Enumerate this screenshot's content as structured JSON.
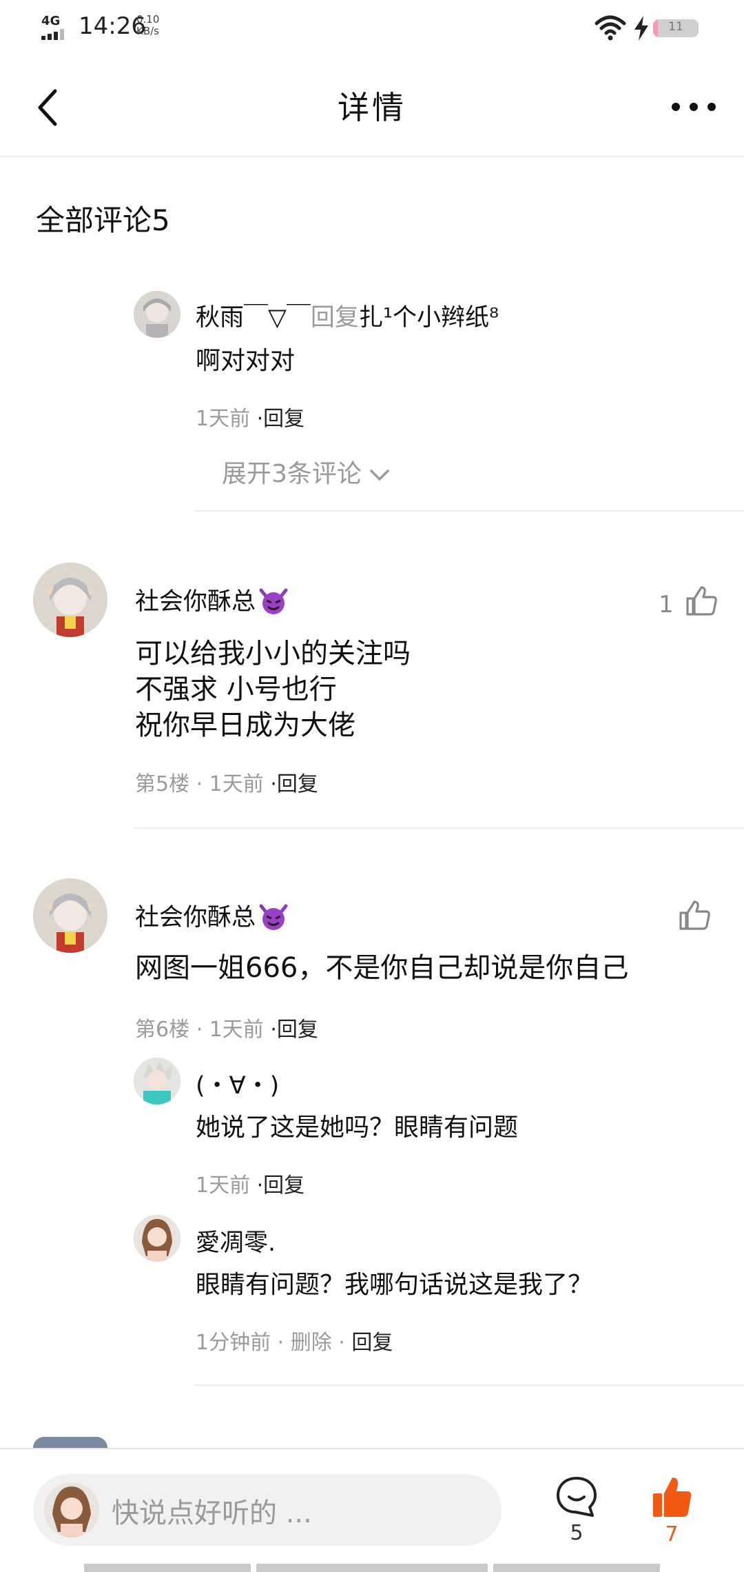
{
  "status_bar": {
    "network": "4G",
    "time": "14:26",
    "speed_value": "0.10",
    "speed_unit": "KB/s",
    "battery": "11",
    "battery_level_percent": 11
  },
  "header": {
    "title": "详情",
    "back_icon": "chevron-left-icon",
    "more_icon": "more-horizontal-icon"
  },
  "section_title": "全部评论5",
  "top_reply": {
    "author": "秋雨￣▽￣",
    "reply_word": "回复",
    "target": "扎¹个小辫纸⁸",
    "text": "啊对对对",
    "time": "1天前",
    "reply_action": "·回复",
    "expand": "展开3条评论"
  },
  "comments": [
    {
      "author": "社会你酥总",
      "emoji": "devil-emoji",
      "likes": "1",
      "lines": [
        "可以给我小小的关注吗",
        "不强求 小号也行",
        "祝你早日成为大佬"
      ],
      "floor": "第5楼",
      "time": "1天前",
      "reply_action": "·回复"
    },
    {
      "author": "社会你酥总",
      "emoji": "devil-emoji",
      "likes": "",
      "lines": [
        "网图一姐666，不是你自己却说是你自己"
      ],
      "floor": "第6楼",
      "time": "1天前",
      "reply_action": "·回复",
      "replies": [
        {
          "author": "(・∀・)",
          "text": "她说了这是她吗？眼睛有问题",
          "time": "1天前",
          "actions": "·回复"
        },
        {
          "author": "愛凋零.",
          "text": "眼睛有问题？我哪句话说这是我了？",
          "time": "1分钟前",
          "delete": "删除",
          "actions": "回复"
        }
      ]
    }
  ],
  "bottom_bar": {
    "placeholder": "快说点好听的 ...",
    "comment_count": "5",
    "like_count": "7",
    "accent_color": "#f25a14"
  }
}
